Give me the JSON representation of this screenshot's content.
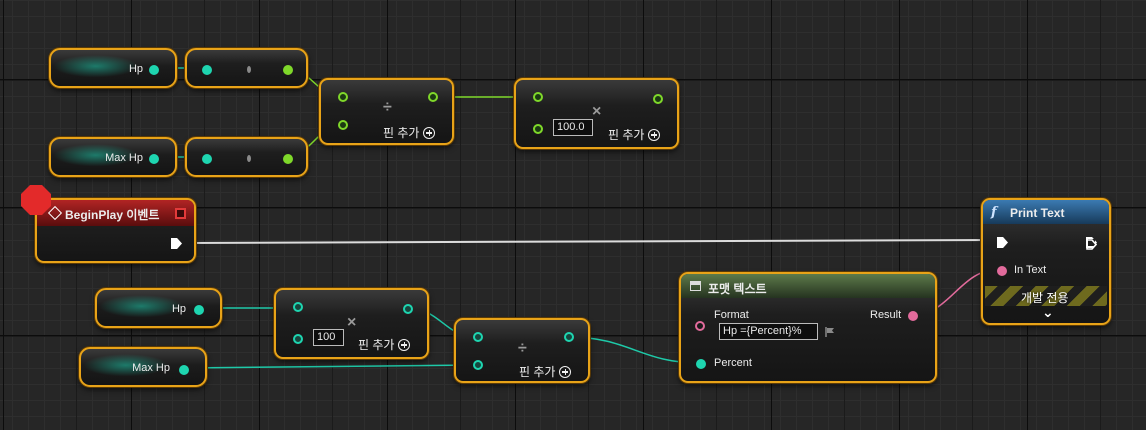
{
  "graph": {
    "variables": {
      "hp_top": "Hp",
      "max_hp_top": "Max Hp",
      "hp_bottom": "Hp",
      "max_hp_bottom": "Max Hp"
    },
    "math_nodes": {
      "divide_symbol": "÷",
      "multiply_symbol": "×",
      "add_pin_label": "핀 추가",
      "multiply_top_value": "100.0",
      "multiply_bottom_value": "100"
    },
    "begin_play": {
      "title": "BeginPlay 이벤트"
    },
    "format_text": {
      "title": "포맷 텍스트",
      "format_label": "Format",
      "format_value": "Hp ={Percent}%",
      "percent_label": "Percent",
      "result_label": "Result"
    },
    "print_text": {
      "title": "Print Text",
      "function_glyph": "f",
      "in_text_label": "In Text",
      "dev_only_label": "개발 전용",
      "expand_glyph": "⌄"
    }
  },
  "colors": {
    "node_border": "#e8a318",
    "float_pin": "#7fd82a",
    "int_pin": "#1ec9a8",
    "text_pin": "#e26b9c",
    "event_title": "#8a1a1a",
    "function_title": "#1f4e7a",
    "format_title": "#3d5a2a"
  }
}
